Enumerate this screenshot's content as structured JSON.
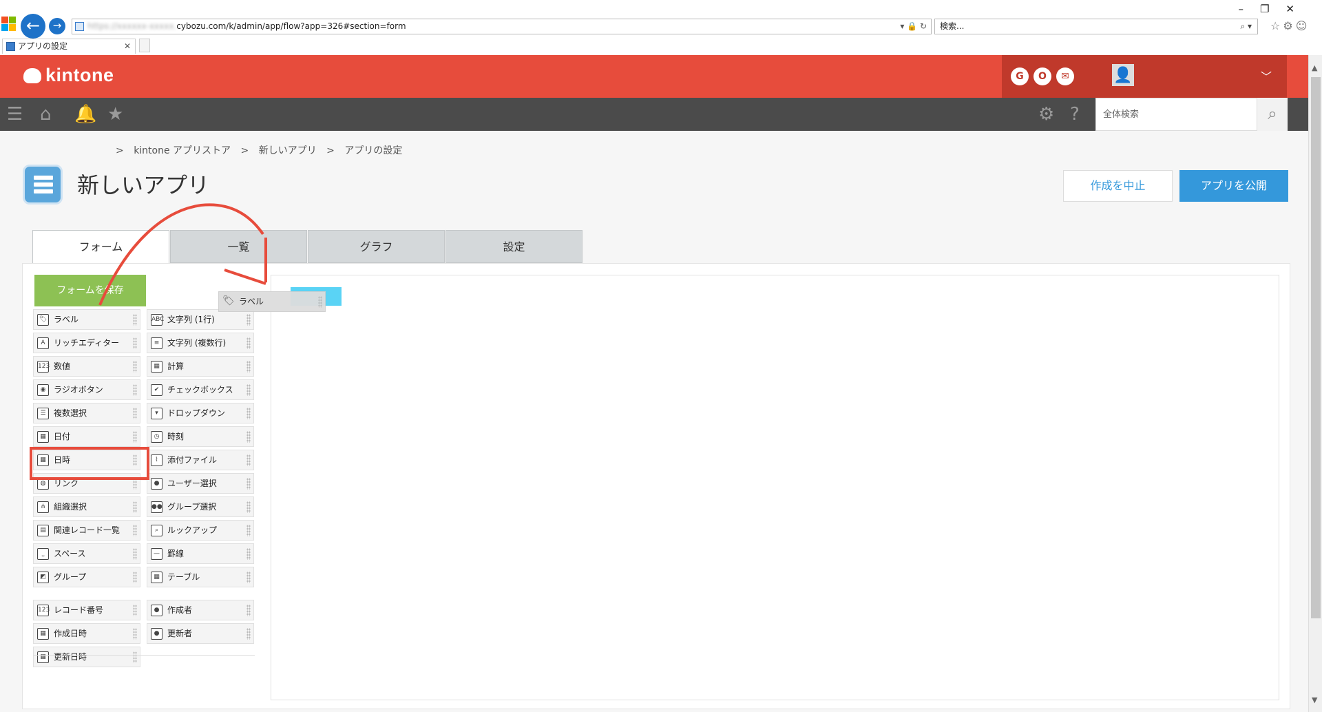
{
  "browser": {
    "url_host": "cybozu.com/k/admin/app/flow?app=326#section=form",
    "url_prefix_blurred": "https://xxxxxx-xxxxx.",
    "search_placeholder": "検索...",
    "tab_title": "アプリの設定"
  },
  "header": {
    "logo": "kintone",
    "apps": [
      "G",
      "O",
      "✉"
    ]
  },
  "global_search": {
    "placeholder": "全体検索"
  },
  "breadcrumb": [
    ">",
    "kintone アプリストア",
    ">",
    "新しいアプリ",
    ">",
    "アプリの設定"
  ],
  "app": {
    "title": "新しいアプリ"
  },
  "actions": {
    "cancel": "作成を中止",
    "publish": "アプリを公開"
  },
  "tabs": [
    "フォーム",
    "一覧",
    "グラフ",
    "設定"
  ],
  "form": {
    "save": "フォームを保存",
    "drag_label": "ラベル",
    "fields_left": [
      {
        "label": "ラベル",
        "icon": "tag-icon"
      },
      {
        "label": "リッチエディター",
        "icon": "rich-text-icon"
      },
      {
        "label": "数値",
        "icon": "number-icon"
      },
      {
        "label": "ラジオボタン",
        "icon": "radio-icon"
      },
      {
        "label": "複数選択",
        "icon": "multi-select-icon"
      },
      {
        "label": "日付",
        "icon": "calendar-icon"
      },
      {
        "label": "日時",
        "icon": "calendar-icon"
      },
      {
        "label": "リンク",
        "icon": "globe-icon"
      },
      {
        "label": "組織選択",
        "icon": "org-icon"
      },
      {
        "label": "関連レコード一覧",
        "icon": "related-records-icon"
      },
      {
        "label": "スペース",
        "icon": "space-icon"
      },
      {
        "label": "グループ",
        "icon": "group-icon"
      }
    ],
    "fields_right": [
      {
        "label": "文字列 (1行)",
        "icon": "text-icon"
      },
      {
        "label": "文字列 (複数行)",
        "icon": "multiline-icon"
      },
      {
        "label": "計算",
        "icon": "calculator-icon"
      },
      {
        "label": "チェックボックス",
        "icon": "checkbox-icon"
      },
      {
        "label": "ドロップダウン",
        "icon": "dropdown-icon"
      },
      {
        "label": "時刻",
        "icon": "clock-icon"
      },
      {
        "label": "添付ファイル",
        "icon": "paperclip-icon"
      },
      {
        "label": "ユーザー選択",
        "icon": "user-icon"
      },
      {
        "label": "グループ選択",
        "icon": "users-icon"
      },
      {
        "label": "ルックアップ",
        "icon": "lookup-icon"
      },
      {
        "label": "罫線",
        "icon": "line-icon"
      },
      {
        "label": "テーブル",
        "icon": "table-icon"
      }
    ],
    "system_left": [
      {
        "label": "レコード番号",
        "icon": "number-icon"
      },
      {
        "label": "作成日時",
        "icon": "calendar-icon"
      },
      {
        "label": "更新日時",
        "icon": "calendar-icon"
      }
    ],
    "system_right": [
      {
        "label": "作成者",
        "icon": "user-icon"
      },
      {
        "label": "更新者",
        "icon": "user-icon"
      }
    ]
  },
  "colors": {
    "brand": "#e74c3c",
    "accent": "#3498db",
    "save": "#8dc154",
    "drop": "#5ad3f5"
  }
}
